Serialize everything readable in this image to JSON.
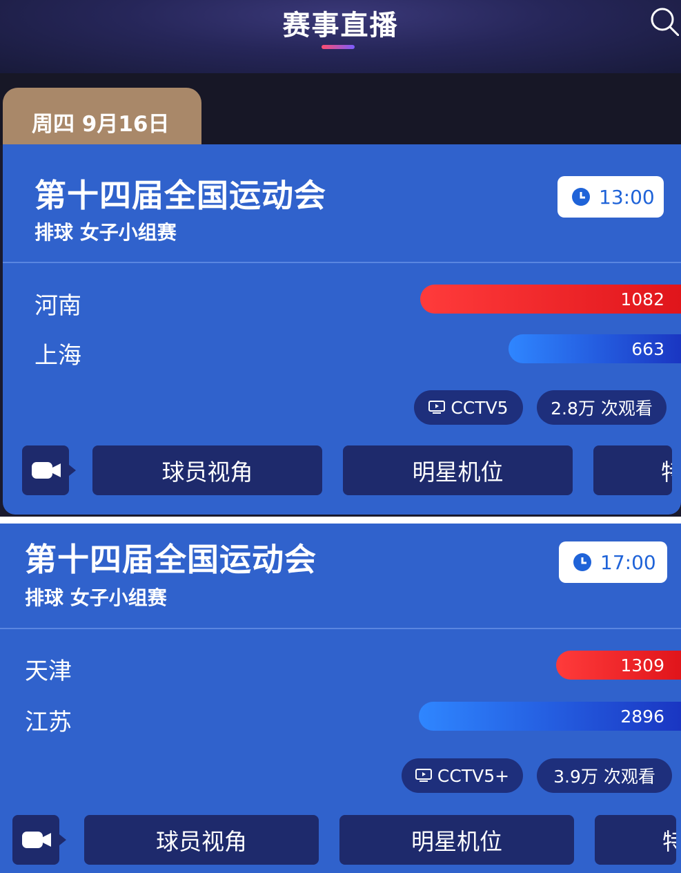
{
  "header": {
    "title": "赛事直播"
  },
  "date_tab": {
    "label": "周四 9月16日"
  },
  "matches": [
    {
      "event": "第十四届全国运动会",
      "subtitle": "排球 女子小组赛",
      "time": "13:00",
      "teams": [
        {
          "name": "河南",
          "votes": "1082",
          "color": "#e0151b"
        },
        {
          "name": "上海",
          "votes": "663",
          "color": "#1a36c2"
        }
      ],
      "channel": "CCTV5",
      "views": "2.8万 次观看",
      "views_buttons": [
        "球员视角",
        "明星机位",
        "特"
      ]
    },
    {
      "event": "第十四届全国运动会",
      "subtitle": "排球 女子小组赛",
      "time": "17:00",
      "teams": [
        {
          "name": "天津",
          "votes": "1309",
          "color": "#e0151b"
        },
        {
          "name": "江苏",
          "votes": "2896",
          "color": "#1a36c2"
        }
      ],
      "channel": "CCTV5+",
      "views": "3.9万 次观看",
      "views_buttons": [
        "球员视角",
        "明星机位",
        "特"
      ]
    }
  ],
  "icons": {
    "search": "search-icon",
    "clock": "clock-icon",
    "tv": "tv-icon",
    "camera": "video-camera-icon"
  },
  "colors": {
    "card_bg": "#3062cc",
    "button_bg": "#1e2a6c",
    "date_tab": "#a98869",
    "time_text": "#1f63d8"
  }
}
